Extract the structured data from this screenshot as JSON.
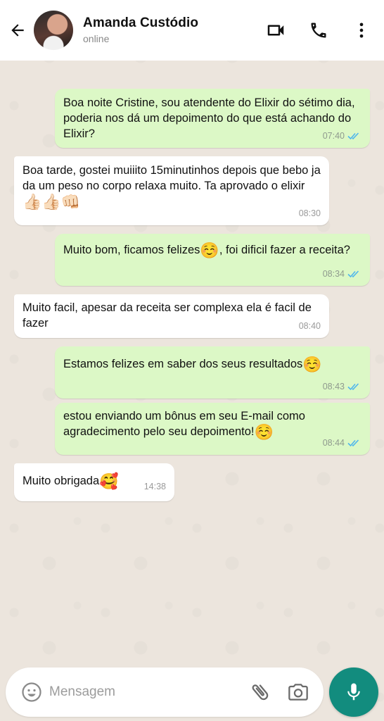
{
  "header": {
    "contact_name": "Amanda Custódio",
    "status": "online",
    "icons": [
      "back-arrow-icon",
      "video-call-icon",
      "phone-icon",
      "more-options-icon"
    ]
  },
  "messages": [
    {
      "direction": "out",
      "text": "Boa noite Cristine, sou atendente do Elixir do sétimo dia, poderia nos dá um depoimento do que está achando do Elixir?",
      "time": "07:40",
      "read": true
    },
    {
      "direction": "in",
      "text": "Boa tarde, gostei muiiito 15minutinhos depois que bebo ja da um peso no corpo relaxa muito. Ta aprovado o elixir",
      "emoji": "👍🏻👍🏻👊🏻",
      "time": "08:30"
    },
    {
      "direction": "out",
      "text_a": "Muito bom, ficamos felizes",
      "emoji": "☺️",
      "text_b": ", foi dificil fazer a receita?",
      "time": "08:34",
      "read": true
    },
    {
      "direction": "in",
      "text": "Muito facil, apesar da receita ser complexa ela é facil de fazer",
      "time": "08:40"
    },
    {
      "direction": "out",
      "text": "Estamos felizes em saber dos seus resultados",
      "emoji": "☺️",
      "time": "08:43",
      "read": true
    },
    {
      "direction": "out",
      "text": "estou enviando um bônus em seu E-mail como agradecimento pelo seu depoimento!",
      "emoji": "☺️",
      "time": "08:44",
      "read": true
    },
    {
      "direction": "in",
      "text": "Muito obrigada",
      "emoji": "🥰",
      "time": "14:38"
    }
  ],
  "composer": {
    "placeholder": "Mensagem"
  },
  "colors": {
    "outgoing_bubble": "#dcf8c6",
    "incoming_bubble": "#ffffff",
    "read_ticks": "#4fb6ec",
    "mic_button": "#128c7e",
    "chat_background": "#ece5dd"
  }
}
